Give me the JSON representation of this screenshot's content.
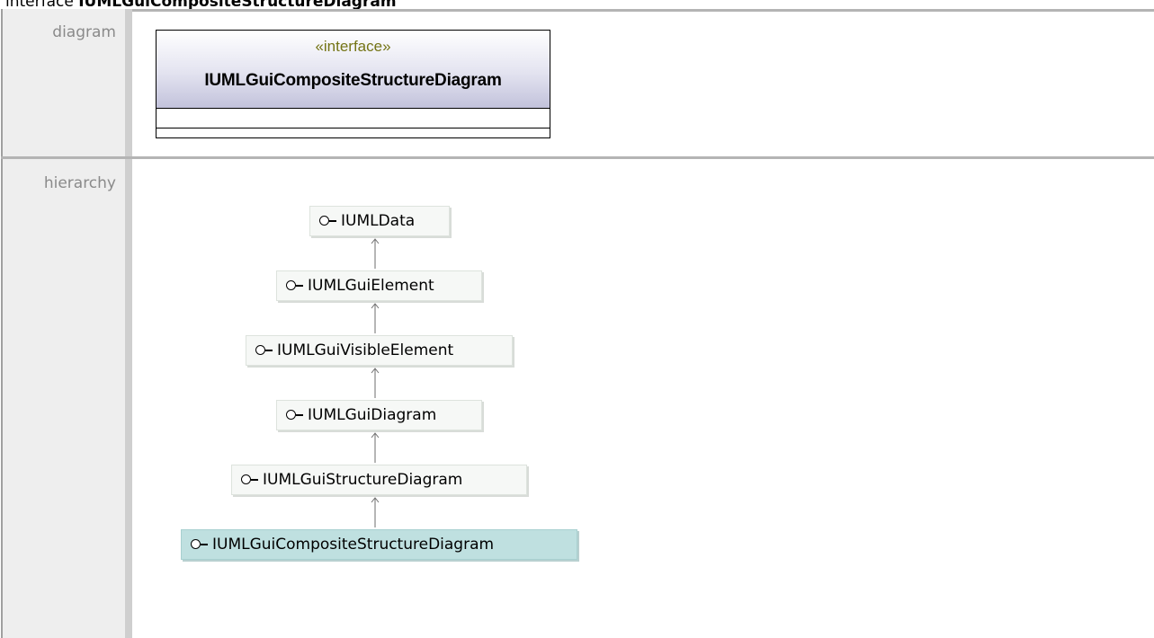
{
  "heading": {
    "prefix": "interface ",
    "name": "IUMLGuiCompositeStructureDiagram"
  },
  "rows": {
    "diagram_label": "diagram",
    "hierarchy_label": "hierarchy"
  },
  "uml": {
    "stereotype": "«interface»",
    "name": "IUMLGuiCompositeStructureDiagram"
  },
  "hierarchy": [
    {
      "label": "IUMLData",
      "current": false
    },
    {
      "label": "IUMLGuiElement",
      "current": false
    },
    {
      "label": "IUMLGuiVisibleElement",
      "current": false
    },
    {
      "label": "IUMLGuiDiagram",
      "current": false
    },
    {
      "label": "IUMLGuiStructureDiagram",
      "current": false
    },
    {
      "label": "IUMLGuiCompositeStructureDiagram",
      "current": true
    }
  ],
  "colors": {
    "node_bg": "#f6f8f6",
    "current_bg": "#bfe0e0",
    "stereotype": "#747416"
  },
  "icons": {
    "node_icon": "interface-lollipop-icon",
    "edge": "generalization-arrow-icon"
  }
}
